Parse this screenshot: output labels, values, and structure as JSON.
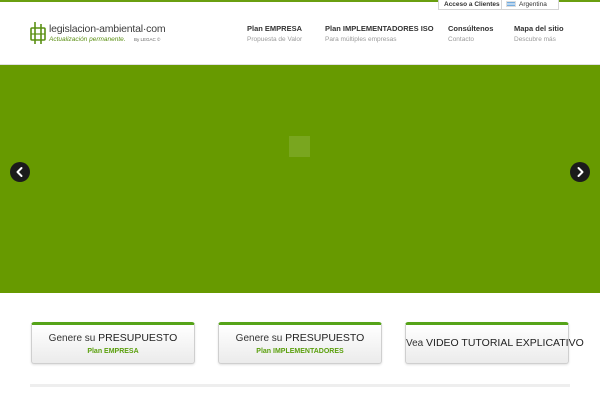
{
  "header": {
    "access_link": "Acceso a Clientes",
    "country_selector": "Argentina"
  },
  "logo": {
    "name": "legislacion-ambiental·com",
    "tagline": "Actualización permanente.",
    "by": "By LEGAC ©"
  },
  "nav": [
    {
      "title": "Plan EMPRESA",
      "subtitle": "Propuesta de Valor"
    },
    {
      "title": "Plan IMPLEMENTADORES ISO",
      "subtitle": "Para múltiples empresas"
    },
    {
      "title": "Consúltenos",
      "subtitle": "Contacto"
    },
    {
      "title": "Mapa del sitio",
      "subtitle": "Descubre más"
    }
  ],
  "slider": {
    "background_color": "#679a00",
    "prev_icon": "chevron-left-icon",
    "next_icon": "chevron-right-icon"
  },
  "cta": [
    {
      "prefix": "Genere su",
      "emphasis": "PRESUPUESTO",
      "sub": "Plan EMPRESA"
    },
    {
      "prefix": "Genere su",
      "emphasis": "PRESUPUESTO",
      "sub": "Plan IMPLEMENTADORES"
    },
    {
      "prefix": "Vea",
      "emphasis": "VIDEO TUTORIAL EXPLICATIVO"
    }
  ],
  "colors": {
    "accent_green": "#6a9f10",
    "slider_green": "#679a00",
    "cta_sub_green": "#5a9f0c"
  }
}
